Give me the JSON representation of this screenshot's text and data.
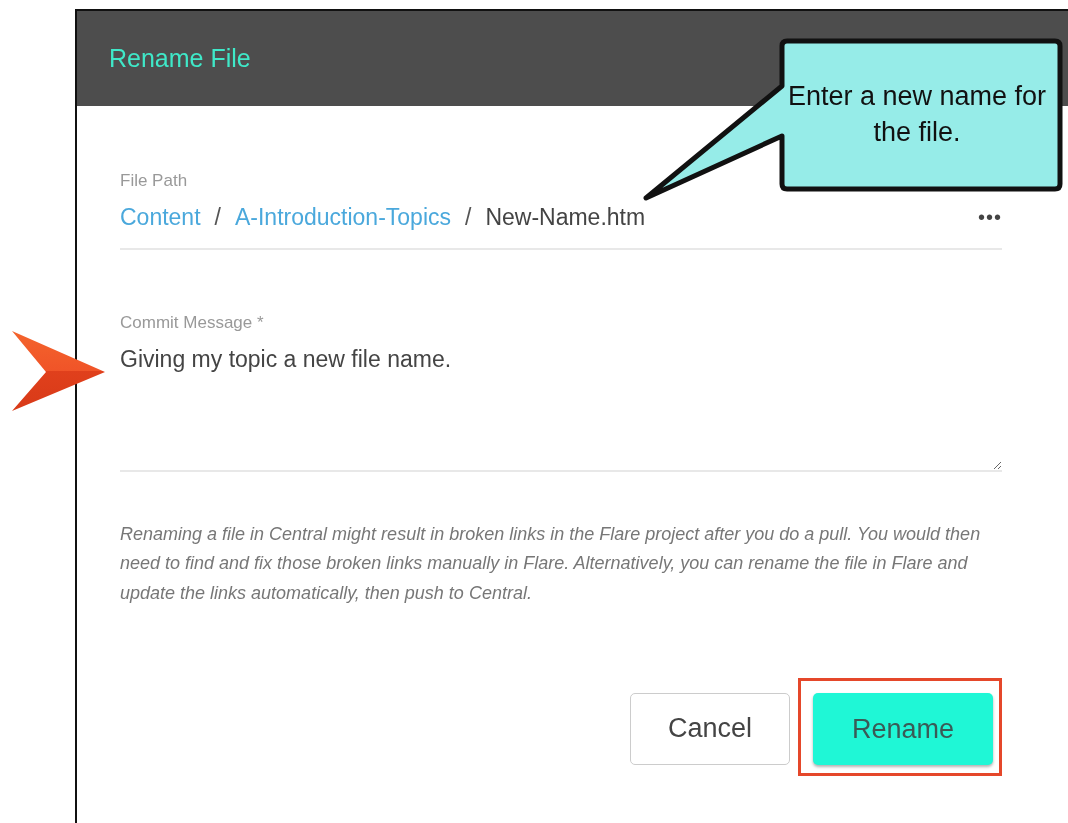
{
  "dialog": {
    "title": "Rename File",
    "file_path": {
      "label": "File Path",
      "segments": [
        {
          "text": "Content",
          "kind": "link"
        },
        {
          "text": "/",
          "kind": "separator"
        },
        {
          "text": "A-Introduction-Topics",
          "kind": "link"
        },
        {
          "text": "/",
          "kind": "separator"
        },
        {
          "text": "New-Name.htm",
          "kind": "current"
        }
      ],
      "more": "•••"
    },
    "commit_message": {
      "label": "Commit Message *",
      "value": "Giving my topic a new file name."
    },
    "note": "Renaming a file in Central might result in broken links in the Flare project after you do a pull. You would then need to find and fix those broken links manually in Flare. Alternatively, you can rename the file in Flare and update the links automatically, then push to Central.",
    "buttons": [
      {
        "label": "Cancel",
        "kind": "secondary",
        "highlighted": false
      },
      {
        "label": "Rename",
        "kind": "primary",
        "highlighted": true
      }
    ]
  },
  "callout": {
    "text": "Enter a new name for the file."
  }
}
